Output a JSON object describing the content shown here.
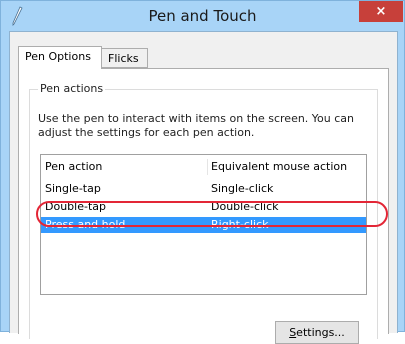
{
  "window": {
    "title": "Pen and Touch",
    "close_label": "×"
  },
  "tabs": [
    {
      "label": "Pen Options",
      "active": true
    },
    {
      "label": "Flicks",
      "active": false
    }
  ],
  "pen_actions": {
    "group_label": "Pen actions",
    "description": "Use the pen to interact with items on the screen.  You can adjust the settings for each pen action.",
    "columns": [
      "Pen action",
      "Equivalent mouse action"
    ],
    "rows": [
      {
        "action": "Single-tap",
        "mouse": "Single-click",
        "selected": false
      },
      {
        "action": "Double-tap",
        "mouse": "Double-click",
        "selected": false
      },
      {
        "action": "Press and hold",
        "mouse": "Right-click",
        "selected": true
      }
    ],
    "settings_button": {
      "accel": "S",
      "rest": "ettings..."
    }
  },
  "colors": {
    "selection": "#3399ff",
    "highlight_ring": "#e32636",
    "close_button": "#c7403a",
    "titlebar": "#a8d4f7"
  }
}
